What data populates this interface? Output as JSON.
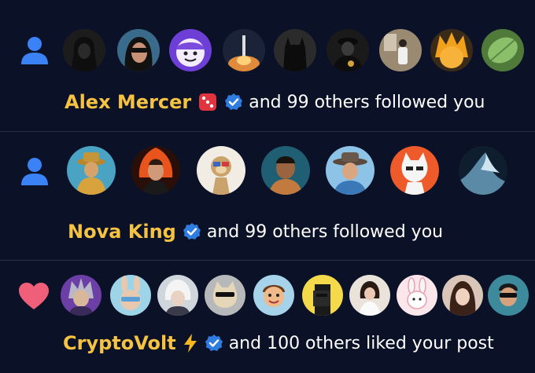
{
  "notifications": [
    {
      "type_icon": "person-icon",
      "avatars": [
        "hooded-figure-avatar",
        "sunglasses-woman-avatar",
        "purple-cartoon-avatar",
        "rocket-launch-avatar",
        "batman-avatar",
        "suited-man-avatar",
        "man-standing-avatar",
        "orange-anime-avatar",
        "green-leaf-avatar"
      ],
      "name": "Alex Mercer",
      "name_emoji": "dice-emoji",
      "verified": true,
      "text": "and 99 others followed you"
    },
    {
      "type_icon": "person-icon",
      "avatars": [
        "man-with-hat-avatar",
        "fire-man-avatar",
        "monkey-cartoon-avatar",
        "man-portrait-avatar",
        "cowboy-hat-avatar",
        "white-cat-avatar",
        "ocean-wave-avatar"
      ],
      "name": "Nova King",
      "verified": true,
      "text": "and 99 others followed you"
    },
    {
      "type_icon": "heart-icon",
      "avatars": [
        "grey-hair-character-avatar",
        "bunny-mask-avatar",
        "white-hair-character-avatar",
        "cool-cat-avatar",
        "cartoon-boy-avatar",
        "pixel-punk-avatar",
        "woman-white-dress-avatar",
        "pink-bunny-avatar",
        "woman-portrait-avatar",
        "sunglasses-man-avatar"
      ],
      "name": "CryptoVolt",
      "name_emoji": "lightning-emoji",
      "verified": true,
      "text": "and 100 others liked your post"
    }
  ],
  "colors": {
    "background": "#0b1126",
    "name": "#f5c242",
    "person_icon": "#3b82f6",
    "heart_icon": "#ef5f7a",
    "verified_badge": "#2f7de1"
  }
}
